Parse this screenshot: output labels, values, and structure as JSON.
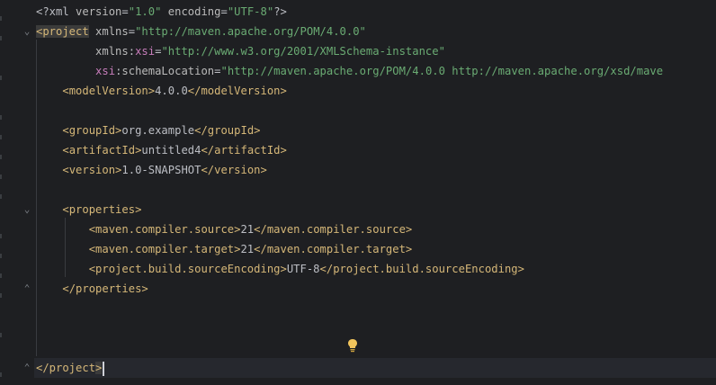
{
  "editor": {
    "lines": [
      {
        "parts": [
          {
            "t": "<?xml ",
            "c": "bracket"
          },
          {
            "t": "version",
            "c": "attr"
          },
          {
            "t": "=",
            "c": "text"
          },
          {
            "t": "\"1.0\"",
            "c": "str"
          },
          {
            "t": " ",
            "c": "text"
          },
          {
            "t": "encoding",
            "c": "attr"
          },
          {
            "t": "=",
            "c": "text"
          },
          {
            "t": "\"UTF-8\"",
            "c": "str"
          },
          {
            "t": "?>",
            "c": "bracket"
          }
        ]
      },
      {
        "parts": [
          {
            "t": "<project",
            "c": "tag tag-hl"
          },
          {
            "t": " ",
            "c": "text"
          },
          {
            "t": "xmlns",
            "c": "attr"
          },
          {
            "t": "=",
            "c": "text"
          },
          {
            "t": "\"http://maven.apache.org/POM/4.0.0\"",
            "c": "str"
          }
        ]
      },
      {
        "parts": [
          {
            "t": "         ",
            "c": "text"
          },
          {
            "t": "xmlns",
            "c": "attr"
          },
          {
            "t": ":",
            "c": "text"
          },
          {
            "t": "xsi",
            "c": "ns"
          },
          {
            "t": "=",
            "c": "text"
          },
          {
            "t": "\"http://www.w3.org/2001/XMLSchema-instance\"",
            "c": "str"
          }
        ]
      },
      {
        "parts": [
          {
            "t": "         ",
            "c": "text"
          },
          {
            "t": "xsi",
            "c": "ns"
          },
          {
            "t": ":",
            "c": "text"
          },
          {
            "t": "schemaLocation",
            "c": "attr"
          },
          {
            "t": "=",
            "c": "text"
          },
          {
            "t": "\"http://maven.apache.org/POM/4.0.0 http://maven.apache.org/xsd/mave",
            "c": "str"
          }
        ]
      },
      {
        "parts": [
          {
            "t": "    ",
            "c": "text"
          },
          {
            "t": "<modelVersion>",
            "c": "tag"
          },
          {
            "t": "4.0.0",
            "c": "text"
          },
          {
            "t": "</modelVersion>",
            "c": "tag"
          }
        ]
      },
      {
        "parts": []
      },
      {
        "parts": [
          {
            "t": "    ",
            "c": "text"
          },
          {
            "t": "<groupId>",
            "c": "tag"
          },
          {
            "t": "org.example",
            "c": "text"
          },
          {
            "t": "</groupId>",
            "c": "tag"
          }
        ]
      },
      {
        "parts": [
          {
            "t": "    ",
            "c": "text"
          },
          {
            "t": "<artifactId>",
            "c": "tag"
          },
          {
            "t": "untitled4",
            "c": "text"
          },
          {
            "t": "</artifactId>",
            "c": "tag"
          }
        ]
      },
      {
        "parts": [
          {
            "t": "    ",
            "c": "text"
          },
          {
            "t": "<version>",
            "c": "tag"
          },
          {
            "t": "1.0-SNAPSHOT",
            "c": "text"
          },
          {
            "t": "</version>",
            "c": "tag"
          }
        ]
      },
      {
        "parts": []
      },
      {
        "parts": [
          {
            "t": "    ",
            "c": "text"
          },
          {
            "t": "<properties>",
            "c": "tag"
          }
        ]
      },
      {
        "parts": [
          {
            "t": "        ",
            "c": "text"
          },
          {
            "t": "<maven.compiler.source>",
            "c": "tag"
          },
          {
            "t": "21",
            "c": "text"
          },
          {
            "t": "</maven.compiler.source>",
            "c": "tag"
          }
        ]
      },
      {
        "parts": [
          {
            "t": "        ",
            "c": "text"
          },
          {
            "t": "<maven.compiler.target>",
            "c": "tag"
          },
          {
            "t": "21",
            "c": "text"
          },
          {
            "t": "</maven.compiler.target>",
            "c": "tag"
          }
        ]
      },
      {
        "parts": [
          {
            "t": "        ",
            "c": "text"
          },
          {
            "t": "<project.build.sourceEncoding>",
            "c": "tag"
          },
          {
            "t": "UTF-8",
            "c": "text"
          },
          {
            "t": "</project.build.sourceEncoding>",
            "c": "tag"
          }
        ]
      },
      {
        "parts": [
          {
            "t": "    ",
            "c": "text"
          },
          {
            "t": "</properties>",
            "c": "tag"
          }
        ]
      },
      {
        "parts": []
      },
      {
        "parts": []
      },
      {
        "parts": []
      },
      {
        "parts": [
          {
            "t": "</project",
            "c": "tag"
          },
          {
            "t": ">",
            "c": "tag tag-hl"
          }
        ]
      }
    ],
    "current_line": 19,
    "fold_markers": [
      {
        "line": 2,
        "glyph": "⌄"
      },
      {
        "line": 11,
        "glyph": "⌄"
      },
      {
        "line": 15,
        "glyph": "⌃"
      },
      {
        "line": 19,
        "glyph": "⌃"
      }
    ],
    "hint_icon": "lightbulb-icon"
  },
  "colors": {
    "background": "#1e1f22",
    "tag": "#d5b778",
    "string": "#6aab73",
    "namespace": "#c77dbb",
    "text": "#bcbec4",
    "bulb": "#f2c55c"
  }
}
